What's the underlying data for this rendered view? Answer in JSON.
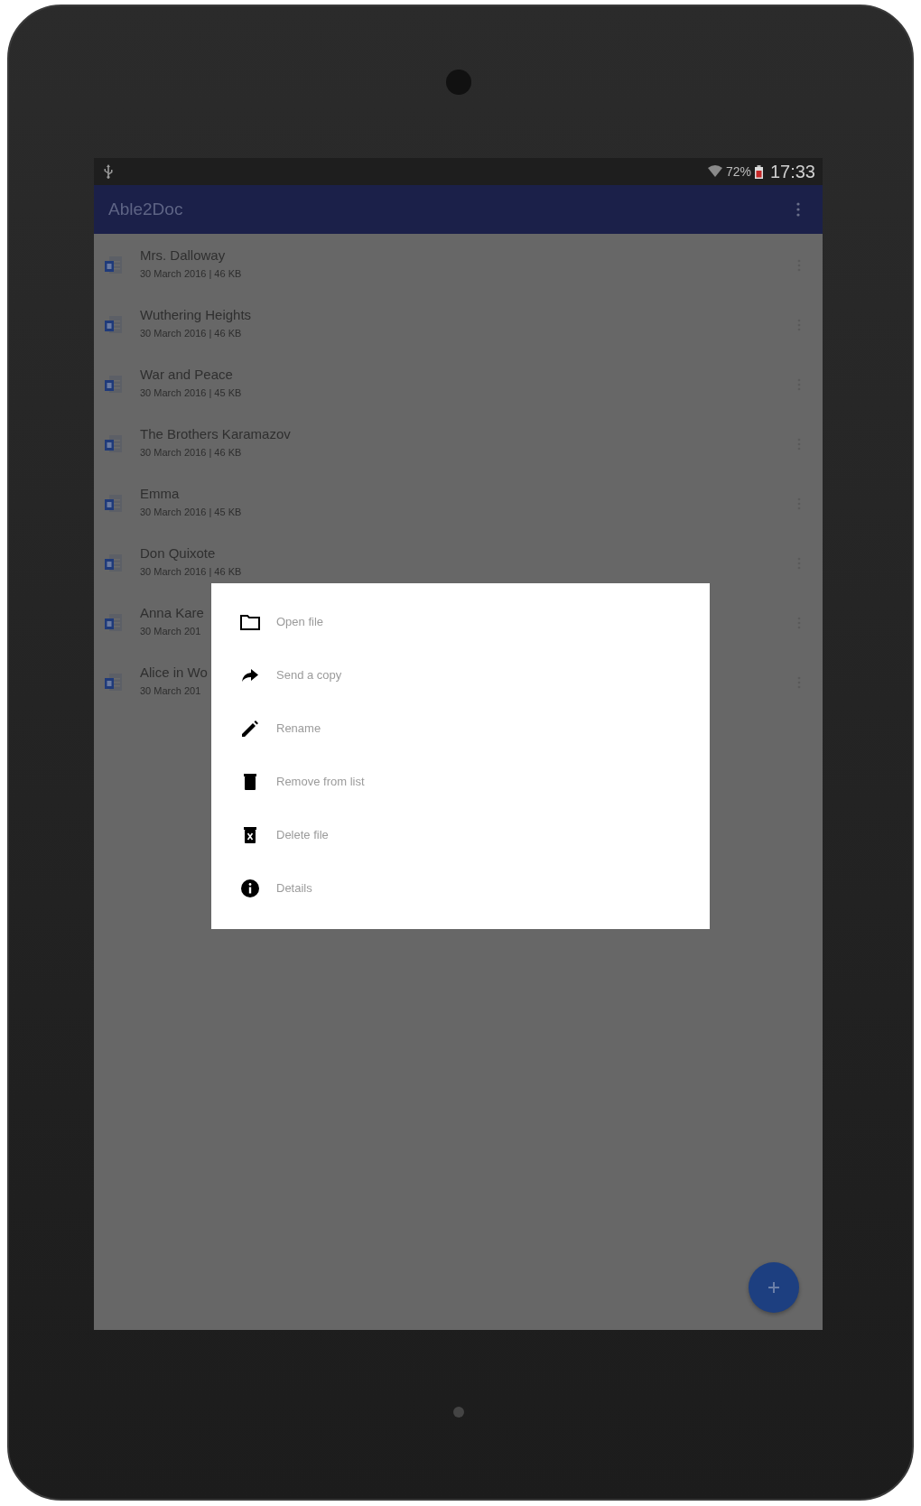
{
  "status_bar": {
    "battery": "72%",
    "time": "17:33"
  },
  "app_bar": {
    "title": "Able2Doc"
  },
  "files": [
    {
      "title": "Mrs. Dalloway",
      "meta": "30 March 2016 | 46 KB"
    },
    {
      "title": "Wuthering Heights",
      "meta": "30 March 2016 | 46 KB"
    },
    {
      "title": "War and Peace",
      "meta": "30 March 2016 | 45 KB"
    },
    {
      "title": "The Brothers Karamazov",
      "meta": "30 March 2016 | 46 KB"
    },
    {
      "title": "Emma",
      "meta": "30 March 2016 | 45 KB"
    },
    {
      "title": "Don Quixote",
      "meta": "30 March 2016 | 46 KB"
    },
    {
      "title": "Anna Kare",
      "meta": "30 March 201"
    },
    {
      "title": "Alice in Wo",
      "meta": "30 March 201"
    }
  ],
  "menu": [
    {
      "kind": "open",
      "label": "Open file"
    },
    {
      "kind": "send",
      "label": "Send a copy"
    },
    {
      "kind": "rename",
      "label": "Rename"
    },
    {
      "kind": "remove",
      "label": "Remove from list"
    },
    {
      "kind": "delete",
      "label": "Delete file"
    },
    {
      "kind": "details",
      "label": "Details"
    }
  ]
}
